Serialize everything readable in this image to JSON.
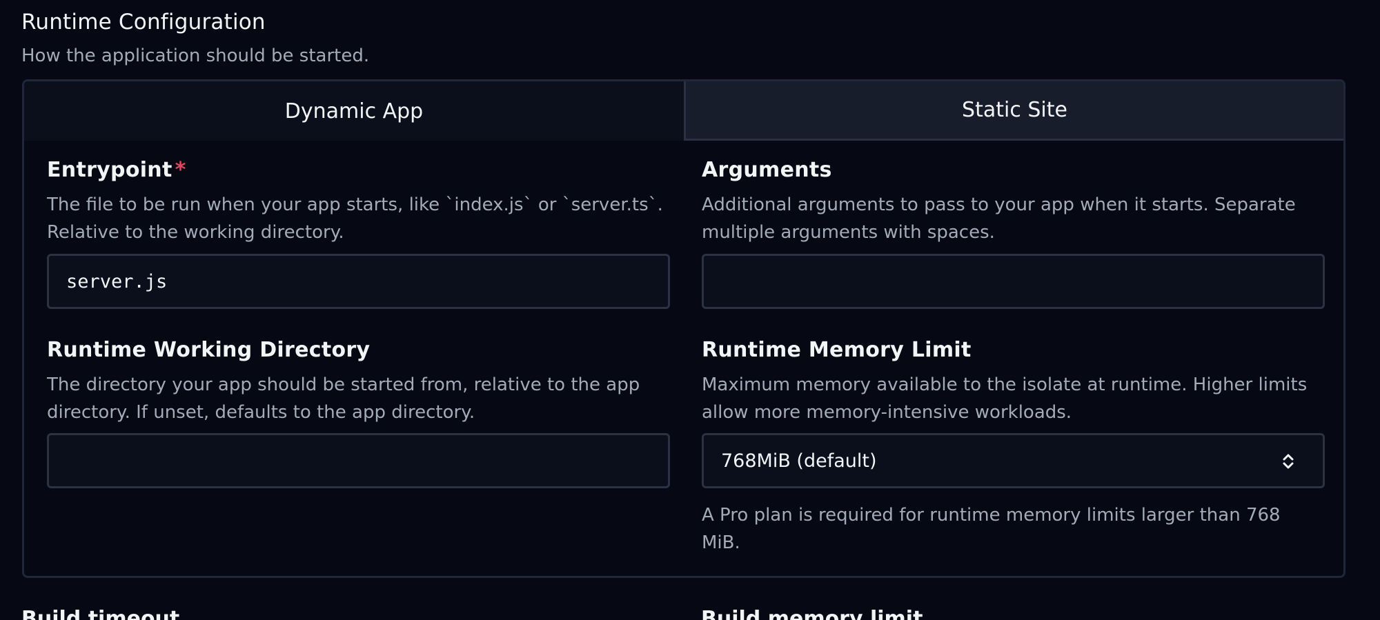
{
  "section": {
    "title": "Runtime Configuration",
    "description": "How the application should be started."
  },
  "tabs": [
    {
      "label": "Dynamic App",
      "active": true
    },
    {
      "label": "Static Site",
      "active": false
    }
  ],
  "fields": {
    "entrypoint": {
      "label": "Entrypoint",
      "required_marker": "*",
      "help": "The file to be run when your app starts, like `index.js` or `server.ts`. Relative to the working directory.",
      "value": "server.js"
    },
    "arguments": {
      "label": "Arguments",
      "help": "Additional arguments to pass to your app when it starts. Separate multiple arguments with spaces.",
      "value": ""
    },
    "working_directory": {
      "label": "Runtime Working Directory",
      "help": "The directory your app should be started from, relative to the app directory. If unset, defaults to the app directory.",
      "value": ""
    },
    "memory_limit": {
      "label": "Runtime Memory Limit",
      "help": "Maximum memory available to the isolate at runtime. Higher limits allow more memory-intensive workloads.",
      "selected": "768MiB (default)",
      "note": "A Pro plan is required for runtime memory limits larger than 768 MiB."
    }
  },
  "below_fold": {
    "build_timeout_label": "Build timeout",
    "build_memory_label": "Build memory limit"
  },
  "colors": {
    "background": "#060914",
    "required": "#e0475a",
    "muted_text": "#a3aab8",
    "border": "#2b3244"
  }
}
